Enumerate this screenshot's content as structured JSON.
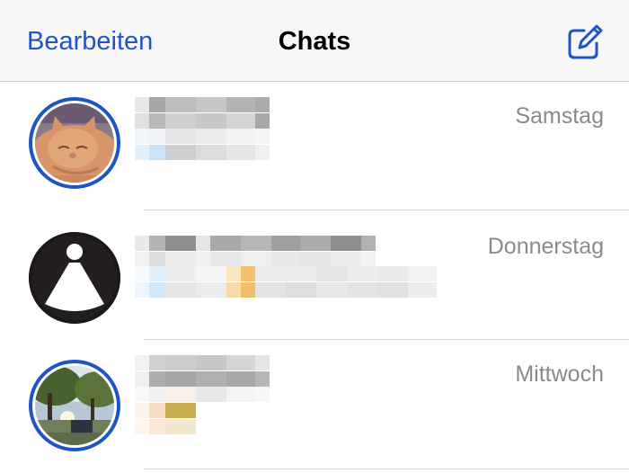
{
  "theme": {
    "accent": "#1e55c4",
    "separator": "#d4d4d6",
    "time_color": "#8a8a8e"
  },
  "navbar": {
    "edit_label": "Bearbeiten",
    "title": "Chats",
    "compose_icon": "compose-icon"
  },
  "chats": [
    {
      "time": "Samstag",
      "avatar": "cat-photo",
      "has_status_ring": true,
      "name_redacted": true,
      "preview_redacted": true
    },
    {
      "time": "Donnerstag",
      "avatar": "black-logo",
      "has_status_ring": false,
      "name_redacted": true,
      "preview_redacted": true
    },
    {
      "time": "Mittwoch",
      "avatar": "park-photo",
      "has_status_ring": true,
      "name_redacted": true,
      "preview_redacted": true
    }
  ]
}
